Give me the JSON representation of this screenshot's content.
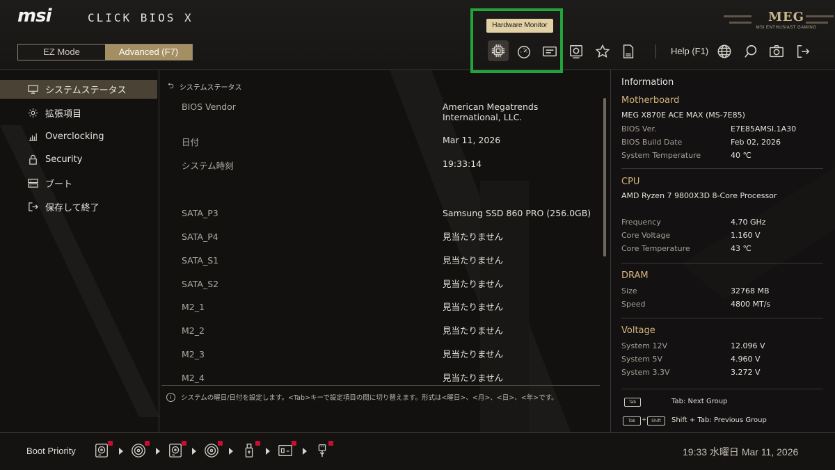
{
  "header": {
    "brand": "msi",
    "product": "CLICK BIOS X",
    "meg": "MEG",
    "meg_sub": "MSI ENTHUSIAST GAMING",
    "modes": {
      "ez": "EZ Mode",
      "advanced": "Advanced (F7)"
    },
    "tooltip": "Hardware Monitor",
    "help": "Help (F1)",
    "toolbar_icons": [
      "cpu-chip-icon",
      "speedometer-icon",
      "board-explorer-icon",
      "hardware-card-icon",
      "favorite-star-icon",
      "bios-log-icon",
      "globe-icon",
      "search-icon",
      "camera-icon",
      "exit-icon"
    ]
  },
  "sidebar": {
    "items": [
      {
        "label": "システムステータス",
        "icon": "monitor-icon",
        "active": true
      },
      {
        "label": "拡張項目",
        "icon": "gear-icon",
        "active": false
      },
      {
        "label": "Overclocking",
        "icon": "chart-bars-icon",
        "active": false
      },
      {
        "label": "Security",
        "icon": "lock-icon",
        "active": false
      },
      {
        "label": "ブート",
        "icon": "boot-drive-icon",
        "active": false
      },
      {
        "label": "保存して終了",
        "icon": "save-exit-icon",
        "active": false
      }
    ]
  },
  "main": {
    "breadcrumb": "システムステータス",
    "rows": [
      {
        "label": "BIOS Vendor",
        "value": "American Megatrends International, LLC."
      },
      {
        "label": "日付",
        "value": "Mar 11, 2026"
      },
      {
        "label": "システム時刻",
        "value": "19:33:14"
      },
      {
        "label": "SATA_P3",
        "value": "Samsung SSD 860 PRO  (256.0GB)"
      },
      {
        "label": "SATA_P4",
        "value": "見当たりません"
      },
      {
        "label": "SATA_S1",
        "value": "見当たりません"
      },
      {
        "label": "SATA_S2",
        "value": "見当たりません"
      },
      {
        "label": "M2_1",
        "value": "見当たりません"
      },
      {
        "label": "M2_2",
        "value": "見当たりません"
      },
      {
        "label": "M2_3",
        "value": "見当たりません"
      },
      {
        "label": "M2_4",
        "value": "見当たりません"
      }
    ],
    "hint": "システムの曜日/日付を設定します。<Tab>キーで設定項目の間に切り替えます。形式は<曜日>、<月>、<日>、<年>です。"
  },
  "info": {
    "title": "Information",
    "motherboard": {
      "title": "Motherboard",
      "model": "MEG X870E ACE MAX (MS-7E85)",
      "items": [
        {
          "k": "BIOS Ver.",
          "v": "E7E85AMSI.1A30"
        },
        {
          "k": "BIOS Build Date",
          "v": "Feb 02, 2026"
        },
        {
          "k": "System Temperature",
          "v": "40 ℃"
        }
      ]
    },
    "cpu": {
      "title": "CPU",
      "model": "AMD Ryzen 7 9800X3D 8-Core Processor",
      "items": [
        {
          "k": "Frequency",
          "v": "4.70 GHz"
        },
        {
          "k": "Core Voltage",
          "v": "1.160 V"
        },
        {
          "k": "Core Temperature",
          "v": "43 ℃"
        }
      ]
    },
    "dram": {
      "title": "DRAM",
      "items": [
        {
          "k": "Size",
          "v": "32768 MB"
        },
        {
          "k": "Speed",
          "v": "4800 MT/s"
        }
      ]
    },
    "voltage": {
      "title": "Voltage",
      "items": [
        {
          "k": "System 12V",
          "v": "12.096 V"
        },
        {
          "k": "System 5V",
          "v": "4.960 V"
        },
        {
          "k": "System 3.3V",
          "v": "3.272 V"
        }
      ]
    },
    "keys": {
      "tab_cap": "Tab",
      "shift_cap": "Shift",
      "next": "Tab: Next Group",
      "prev": "Shift + Tab: Previous Group"
    }
  },
  "bottom": {
    "boot_priority": "Boot Priority",
    "devices": [
      "hdd-icon",
      "optical-disc-icon",
      "hdd-icon",
      "optical-disc-icon",
      "usb-drive-icon",
      "usb-device-icon",
      "usb-plug-icon"
    ],
    "datetime": "19:33  水曜日 Mar 11, 2026"
  }
}
